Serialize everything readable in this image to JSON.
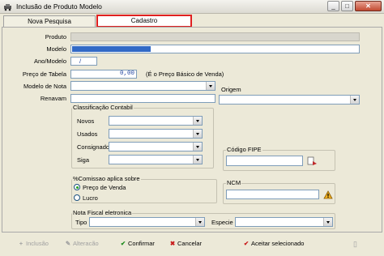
{
  "window": {
    "title": "Inclusão de Produto Modelo",
    "min": "_",
    "max": "□",
    "close": "✕"
  },
  "tabs": [
    {
      "label": "Nova Pesquisa"
    },
    {
      "label": "Cadastro"
    }
  ],
  "form": {
    "produto_label": "Produto",
    "modelo_label": "Modelo",
    "ano_label": "Ano/Modelo",
    "ano_value": "/",
    "preco_label": "Preço de Tabela",
    "preco_value": "0,00",
    "preco_hint": "(É o Preço Básico de Venda)",
    "modelo_nota_label": "Modelo de Nota",
    "renavam_label": "Renavam",
    "origem_label": "Origem"
  },
  "classificacao": {
    "title": "Classificação Contabil",
    "items": [
      {
        "label": "Novos"
      },
      {
        "label": "Usados"
      },
      {
        "label": "Consignado"
      },
      {
        "label": "Siga"
      }
    ]
  },
  "fipe": {
    "label": "Código FIPE"
  },
  "comissao": {
    "title": "%Comissao aplica sobre",
    "options": [
      {
        "label": "Preço de Venda",
        "selected": true
      },
      {
        "label": "Lucro",
        "selected": false
      }
    ]
  },
  "ncm": {
    "label": "NCM"
  },
  "nota_fiscal": {
    "title": "Nota Fiscal eletronica",
    "tipo_label": "Tipo",
    "especie_label": "Especie"
  },
  "toolbar": {
    "inclusao": "Inclusão",
    "alteracao": "Alteracão",
    "confirmar": "Confirmar",
    "cancelar": "Cancelar",
    "aceitar": "Aceitar selecionado"
  },
  "colors": {
    "selection": "#3169c6",
    "active_tab_border": "#e02020"
  }
}
